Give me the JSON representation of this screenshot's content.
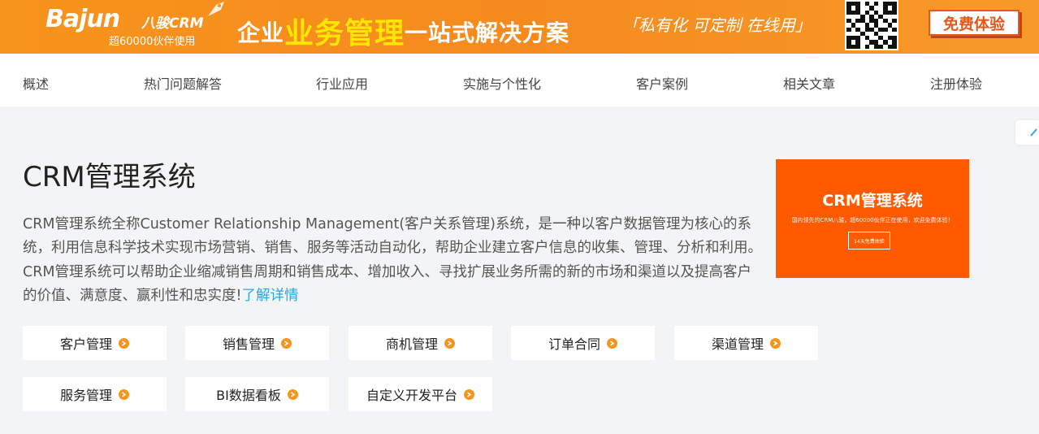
{
  "banner": {
    "logo_text": "Bajun",
    "logo_cn": "八骏CRM",
    "logo_partners": "超60000伙伴使用",
    "slogan_pre": "企业",
    "slogan_hl": "业务管理",
    "slogan_post": "一站式解决方案",
    "slogan_quote": "「私有化 可定制 在线用」",
    "trial_label": "免费体验",
    "colors": {
      "accent": "#f7941d",
      "highlight": "#ffe600"
    }
  },
  "nav": {
    "items": [
      {
        "label": "概述"
      },
      {
        "label": "热门问题解答"
      },
      {
        "label": "行业应用"
      },
      {
        "label": "实施与个性化"
      },
      {
        "label": "客户案例"
      },
      {
        "label": "相关文章"
      },
      {
        "label": "注册体验"
      }
    ]
  },
  "main": {
    "title": "CRM管理系统",
    "description": "CRM管理系统全称Customer Relationship Management(客户关系管理)系统，是一种以客户数据管理为核心的系统，利用信息科学技术实现市场营销、销售、服务等活动自动化，帮助企业建立客户信息的收集、管理、分析和利用。CRM管理系统可以帮助企业缩减销售周期和销售成本、增加收入、寻找扩展业务所需的新的市场和渠道以及提高客户的价值、满意度、赢利性和忠实度!",
    "more_link": "了解详情",
    "link_color": "#2aa7e0"
  },
  "promo": {
    "title": "CRM管理系统",
    "subtitle": "国内领先的CRM八骏，超60000伙伴正在使用，欢迎免费体验！",
    "button": "14天免费体验",
    "color": "#ff5a00"
  },
  "modules": [
    {
      "label": "客户管理",
      "icon": "arrow-right-circle-icon"
    },
    {
      "label": "销售管理",
      "icon": "arrow-right-circle-icon"
    },
    {
      "label": "商机管理",
      "icon": "arrow-right-circle-icon"
    },
    {
      "label": "订单合同",
      "icon": "arrow-right-circle-icon"
    },
    {
      "label": "渠道管理",
      "icon": "arrow-right-circle-icon"
    },
    {
      "label": "服务管理",
      "icon": "arrow-right-circle-icon"
    },
    {
      "label": "BI数据看板",
      "icon": "arrow-right-circle-icon"
    },
    {
      "label": "自定义开发平台",
      "icon": "arrow-right-circle-icon"
    }
  ]
}
